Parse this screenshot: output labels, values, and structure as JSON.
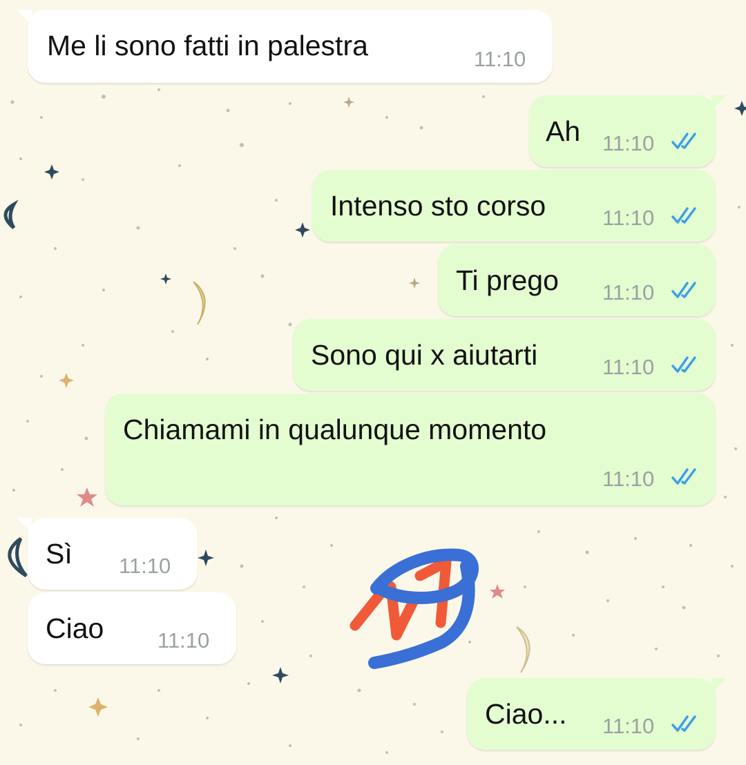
{
  "chat": {
    "messages": [
      {
        "direction": "incoming",
        "text": "Me li sono fatti in palestra",
        "time": "11:10"
      },
      {
        "direction": "outgoing",
        "text": "Ah",
        "time": "11:10",
        "status": "read"
      },
      {
        "direction": "outgoing",
        "text": "Intenso sto corso",
        "time": "11:10",
        "status": "read"
      },
      {
        "direction": "outgoing",
        "text": "Ti prego",
        "time": "11:10",
        "status": "read"
      },
      {
        "direction": "outgoing",
        "text": "Sono qui x aiutarti",
        "time": "11:10",
        "status": "read"
      },
      {
        "direction": "outgoing",
        "text": "Chiamami in qualunque momento",
        "time": "11:10",
        "status": "read"
      },
      {
        "direction": "incoming",
        "text": "Sì",
        "time": "11:10"
      },
      {
        "direction": "incoming",
        "text": "Ciao",
        "time": "11:10"
      },
      {
        "direction": "outgoing",
        "text": "Ciao...",
        "time": "11:10",
        "status": "read"
      }
    ]
  },
  "colors": {
    "wallpaper": "#fbf8ea",
    "incoming_bubble": "#ffffff",
    "outgoing_bubble": "#e4fdd0",
    "read_ticks": "#3d9ee8",
    "scribble_red": "#f05a38",
    "scribble_blue": "#3a6fd6"
  },
  "icons": {
    "read_receipt": "double-check-icon",
    "wallpaper_decor": [
      "star-icon",
      "moon-icon"
    ]
  }
}
